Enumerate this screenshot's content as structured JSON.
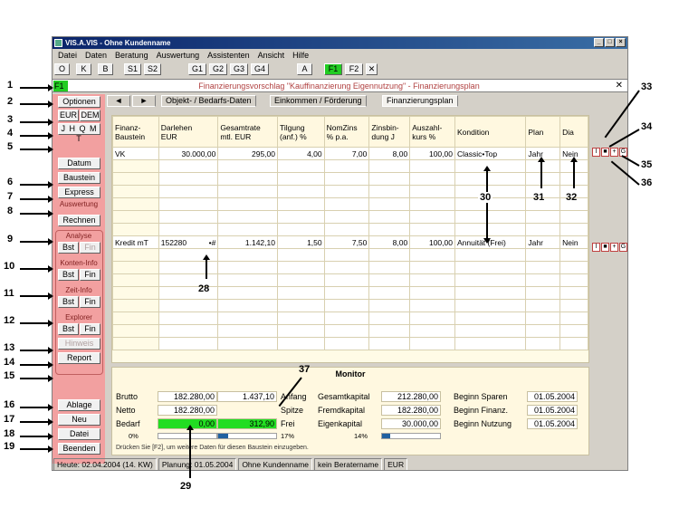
{
  "window": {
    "title": "VIS.A.VIS - Ohne Kundenname"
  },
  "menu": [
    "Datei",
    "Daten",
    "Beratung",
    "Auswertung",
    "Assistenten",
    "Ansicht",
    "Hilfe"
  ],
  "toolbar": {
    "buttons": [
      "O",
      "K",
      "B",
      "S1",
      "S2",
      "G1",
      "G2",
      "G3",
      "G4",
      "A",
      "F1",
      "F2",
      "✕"
    ]
  },
  "header": {
    "tag": "F1",
    "title": "Finanzierungsvorschlag \"Kauffinanzierung Eigennutzung\" - Finanzierungsplan",
    "close": "✕"
  },
  "tabs": {
    "nav_left": "◄",
    "nav_right": "►",
    "items": [
      "Objekt- / Bedarfs-Daten",
      "Einkommen / Förderung",
      "Finanzierungsplan"
    ]
  },
  "sidebar": {
    "optionen": "Optionen",
    "eur": "EUR",
    "dem": "DEM",
    "periods": "J H Q M T",
    "datum": "Datum",
    "baustein": "Baustein",
    "express": "Express",
    "auswertung_label": "Auswertung",
    "rechnen": "Rechnen",
    "analyse_label": "Analyse",
    "analyse_bst": "Bst",
    "analyse_fin": "Fin",
    "konten_label": "Konten-Info",
    "konten_bst": "Bst",
    "konten_fin": "Fin",
    "zeit_label": "Zeit-Info",
    "zeit_bst": "Bst",
    "zeit_fin": "Fin",
    "explorer_label": "Explorer",
    "explorer_bst": "Bst",
    "explorer_fin": "Fin",
    "hinweis": "Hinweis",
    "report": "Report",
    "ablage": "Ablage",
    "neu": "Neu",
    "datei": "Datei",
    "beenden": "Beenden"
  },
  "grid": {
    "headers": [
      "Finanz-\nBaustein",
      "Darlehen\nEUR",
      "Gesamtrate\nmtl. EUR",
      "Tilgung\n(anf.) %",
      "NomZins\n% p.a.",
      "Zinsbin-\ndung J",
      "Auszahl-\nkurs %",
      "Kondition",
      "Plan",
      "Dia"
    ],
    "row_vk": {
      "baustein": "VK",
      "darlehen": "30.000,00",
      "rate": "295,00",
      "tilgung": "4,00",
      "zins": "7,00",
      "bindung": "8,00",
      "kurs": "100,00",
      "kondition": "Classic•Top",
      "plan": "Jahr",
      "dia": "Nein"
    },
    "row_kredit": {
      "baustein": "Kredit mT",
      "darlehen": "152280",
      "marker": "•#",
      "rate": "1.142,10",
      "tilgung": "1,50",
      "zins": "7,50",
      "bindung": "8,00",
      "kurs": "100,00",
      "kondition": "Annuität  (Frei)",
      "plan": "Jahr",
      "dia": "Nein"
    },
    "row_buttons": [
      "I",
      "■",
      "+",
      "G"
    ]
  },
  "monitor": {
    "title": "Monitor",
    "brutto_label": "Brutto",
    "brutto_value": "182.280,00",
    "brutto_rate": "1.437,10",
    "netto_label": "Netto",
    "netto_value": "182.280,00",
    "bedarf_label": "Bedarf",
    "bedarf_value": "0,00",
    "bedarf_rate": "312,90",
    "pct_left": "0%",
    "pct_mid": "17%",
    "pct_right": "14%",
    "anfang": "Anfang",
    "spitze": "Spitze",
    "frei": "Frei",
    "gesamtkapital_label": "Gesamtkapital",
    "gesamtkapital": "212.280,00",
    "fremdkapital_label": "Fremdkapital",
    "fremdkapital": "182.280,00",
    "eigenkapital_label": "Eigenkapital",
    "eigenkapital": "30.000,00",
    "beginn_sparen_label": "Beginn Sparen",
    "beginn_sparen": "01.05.2004",
    "beginn_finanz_label": "Beginn Finanz.",
    "beginn_finanz": "01.05.2004",
    "beginn_nutzung_label": "Beginn Nutzung",
    "beginn_nutzung": "01.05.2004",
    "progress_mid": 0.17,
    "progress_right": 0.14,
    "hint": "Drücken Sie [F2], um weitere Daten für diesen Baustein einzugeben."
  },
  "status": [
    "Heute: 02.04.2004 (14. KW)",
    "Planung: 01.05.2004",
    "Ohne Kundenname",
    "kein Beratername",
    "EUR"
  ],
  "callouts": [
    "1",
    "2",
    "3",
    "4",
    "5",
    "6",
    "7",
    "8",
    "9",
    "10",
    "11",
    "12",
    "13",
    "14",
    "15",
    "16",
    "17",
    "18",
    "19",
    "28",
    "29",
    "30",
    "31",
    "32",
    "33",
    "34",
    "35",
    "36",
    "37"
  ],
  "colors": {
    "sidebar": "#f2a0a0",
    "accent_green": "#22cc22",
    "grid_bg": "#fffbe6",
    "title_red": "#b04040"
  }
}
